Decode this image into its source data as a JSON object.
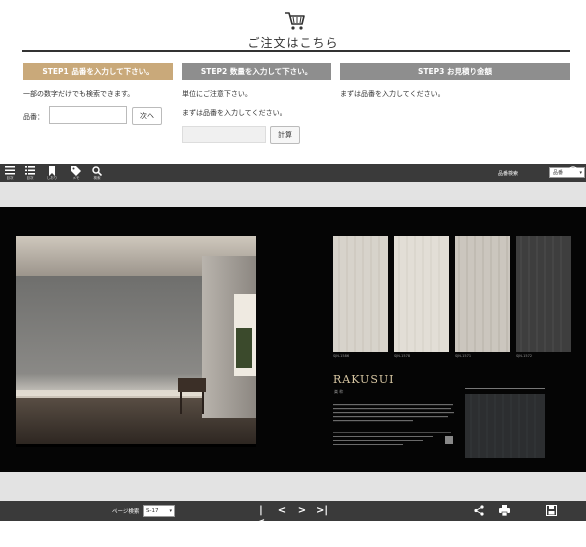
{
  "header": {
    "cart_icon": "shopping-cart-icon",
    "title": "ご注文はこちら"
  },
  "steps": {
    "step1": {
      "tab": "STEP1 品番を入力して下さい。",
      "note": "一部の数字だけでも検索できます。",
      "part_label": "品番：",
      "next_button": "次へ"
    },
    "step2": {
      "tab": "STEP2 数量を入力して下さい。",
      "note1": "単位にご注意下さい。",
      "note2": "まずは品番を入力してください。",
      "calc_button": "計算"
    },
    "step3": {
      "tab": "STEP3 お見積り金額",
      "note": "まずは品番を入力してください。"
    }
  },
  "viewer": {
    "toolbar": [
      {
        "icon": "menu-icon",
        "label": "目次"
      },
      {
        "icon": "list-icon",
        "label": "目次"
      },
      {
        "icon": "bookmark-icon",
        "label": "しおり"
      },
      {
        "icon": "tag-icon",
        "label": "メモ"
      },
      {
        "icon": "search-icon",
        "label": "検索"
      }
    ],
    "search_label": "品番検索",
    "search_select": "品番",
    "help_icon": "help-icon",
    "book": {
      "swatch_codes": [
        "SJN-1586",
        "SJN-1578",
        "SJN-1571",
        "SJN-1572"
      ],
      "product_title": "RAKUSUI",
      "product_subtitle": "楽 粋"
    },
    "bottom": {
      "page_search_label": "ページ検索",
      "page_select": "S-17",
      "nav": [
        "|<",
        "<",
        ">",
        ">|"
      ],
      "share_icon": "share-icon",
      "print_icon": "print-icon",
      "save_icon": "save-icon"
    }
  }
}
